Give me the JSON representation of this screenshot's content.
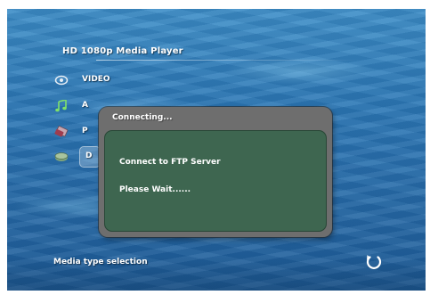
{
  "app": {
    "title": "HD 1080p Media Player"
  },
  "menu": {
    "items": [
      {
        "label": "VIDEO",
        "icon": "video-icon"
      },
      {
        "label": "A",
        "icon": "music-icon"
      },
      {
        "label": "P",
        "icon": "photo-icon"
      },
      {
        "label": "D",
        "icon": "data-icon"
      }
    ],
    "selected_index": 3
  },
  "dialog": {
    "title": "Connecting...",
    "line1": "Connect to FTP Server",
    "line2": "Please Wait......"
  },
  "status": {
    "text": "Media type selection",
    "back_icon": "back-arrow-icon"
  },
  "colors": {
    "dialog_frame": "#6e6e6e",
    "dialog_body": "#3e6650",
    "water": "#2e79b6"
  }
}
